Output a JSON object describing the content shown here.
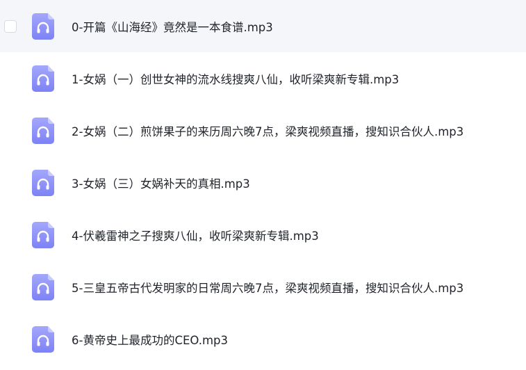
{
  "file_list": {
    "icon_name": "audio-file-headphones-icon",
    "icon_color_top": "#a4a8fb",
    "icon_color_bottom": "#7d82f5",
    "hover_background": "#f5f6fa",
    "items": [
      {
        "name": "0-开篇《山海经》竟然是一本食谱.mp3",
        "hovered": true
      },
      {
        "name": "1-女娲（一）创世女神的流水线搜爽八仙，收听梁爽新专辑.mp3",
        "hovered": false
      },
      {
        "name": "2-女娲（二）煎饼果子的来历周六晚7点，梁爽视频直播，搜知识合伙人.mp3",
        "hovered": false
      },
      {
        "name": "3-女娲（三）女娲补天的真相.mp3",
        "hovered": false
      },
      {
        "name": "4-伏羲雷神之子搜爽八仙，收听梁爽新专辑.mp3",
        "hovered": false
      },
      {
        "name": "5-三皇五帝古代发明家的日常周六晚7点，梁爽视频直播，搜知识合伙人.mp3",
        "hovered": false
      },
      {
        "name": "6-黄帝史上最成功的CEO.mp3",
        "hovered": false
      }
    ]
  }
}
